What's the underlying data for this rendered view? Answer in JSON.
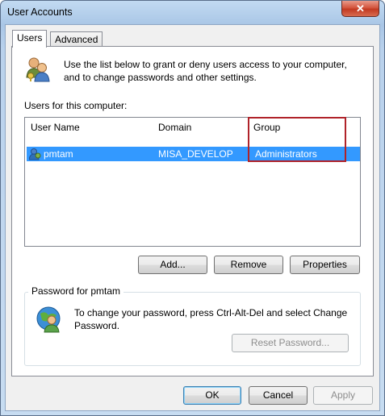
{
  "window": {
    "title": "User Accounts",
    "close_glyph": "✕"
  },
  "tabs": [
    {
      "label": "Users",
      "active": true
    },
    {
      "label": "Advanced",
      "active": false
    }
  ],
  "intro_text": "Use the list below to grant or deny users access to your computer, and to change passwords and other settings.",
  "users_label": "Users for this computer:",
  "table": {
    "columns": [
      "User Name",
      "Domain",
      "Group"
    ],
    "rows": [
      {
        "user": "pmtam",
        "domain": "MISA_DEVELOP",
        "group": "Administrators",
        "selected": true
      }
    ]
  },
  "buttons": {
    "add": "Add...",
    "remove": "Remove",
    "properties": "Properties"
  },
  "password_group": {
    "legend": "Password for pmtam",
    "text": "To change your password, press Ctrl-Alt-Del and select Change Password.",
    "reset_button": "Reset Password..."
  },
  "footer": {
    "ok": "OK",
    "cancel": "Cancel",
    "apply": "Apply"
  },
  "colors": {
    "selection": "#3399ff",
    "highlight_box": "#b0232a",
    "title_bar": "#a9c6e6"
  }
}
